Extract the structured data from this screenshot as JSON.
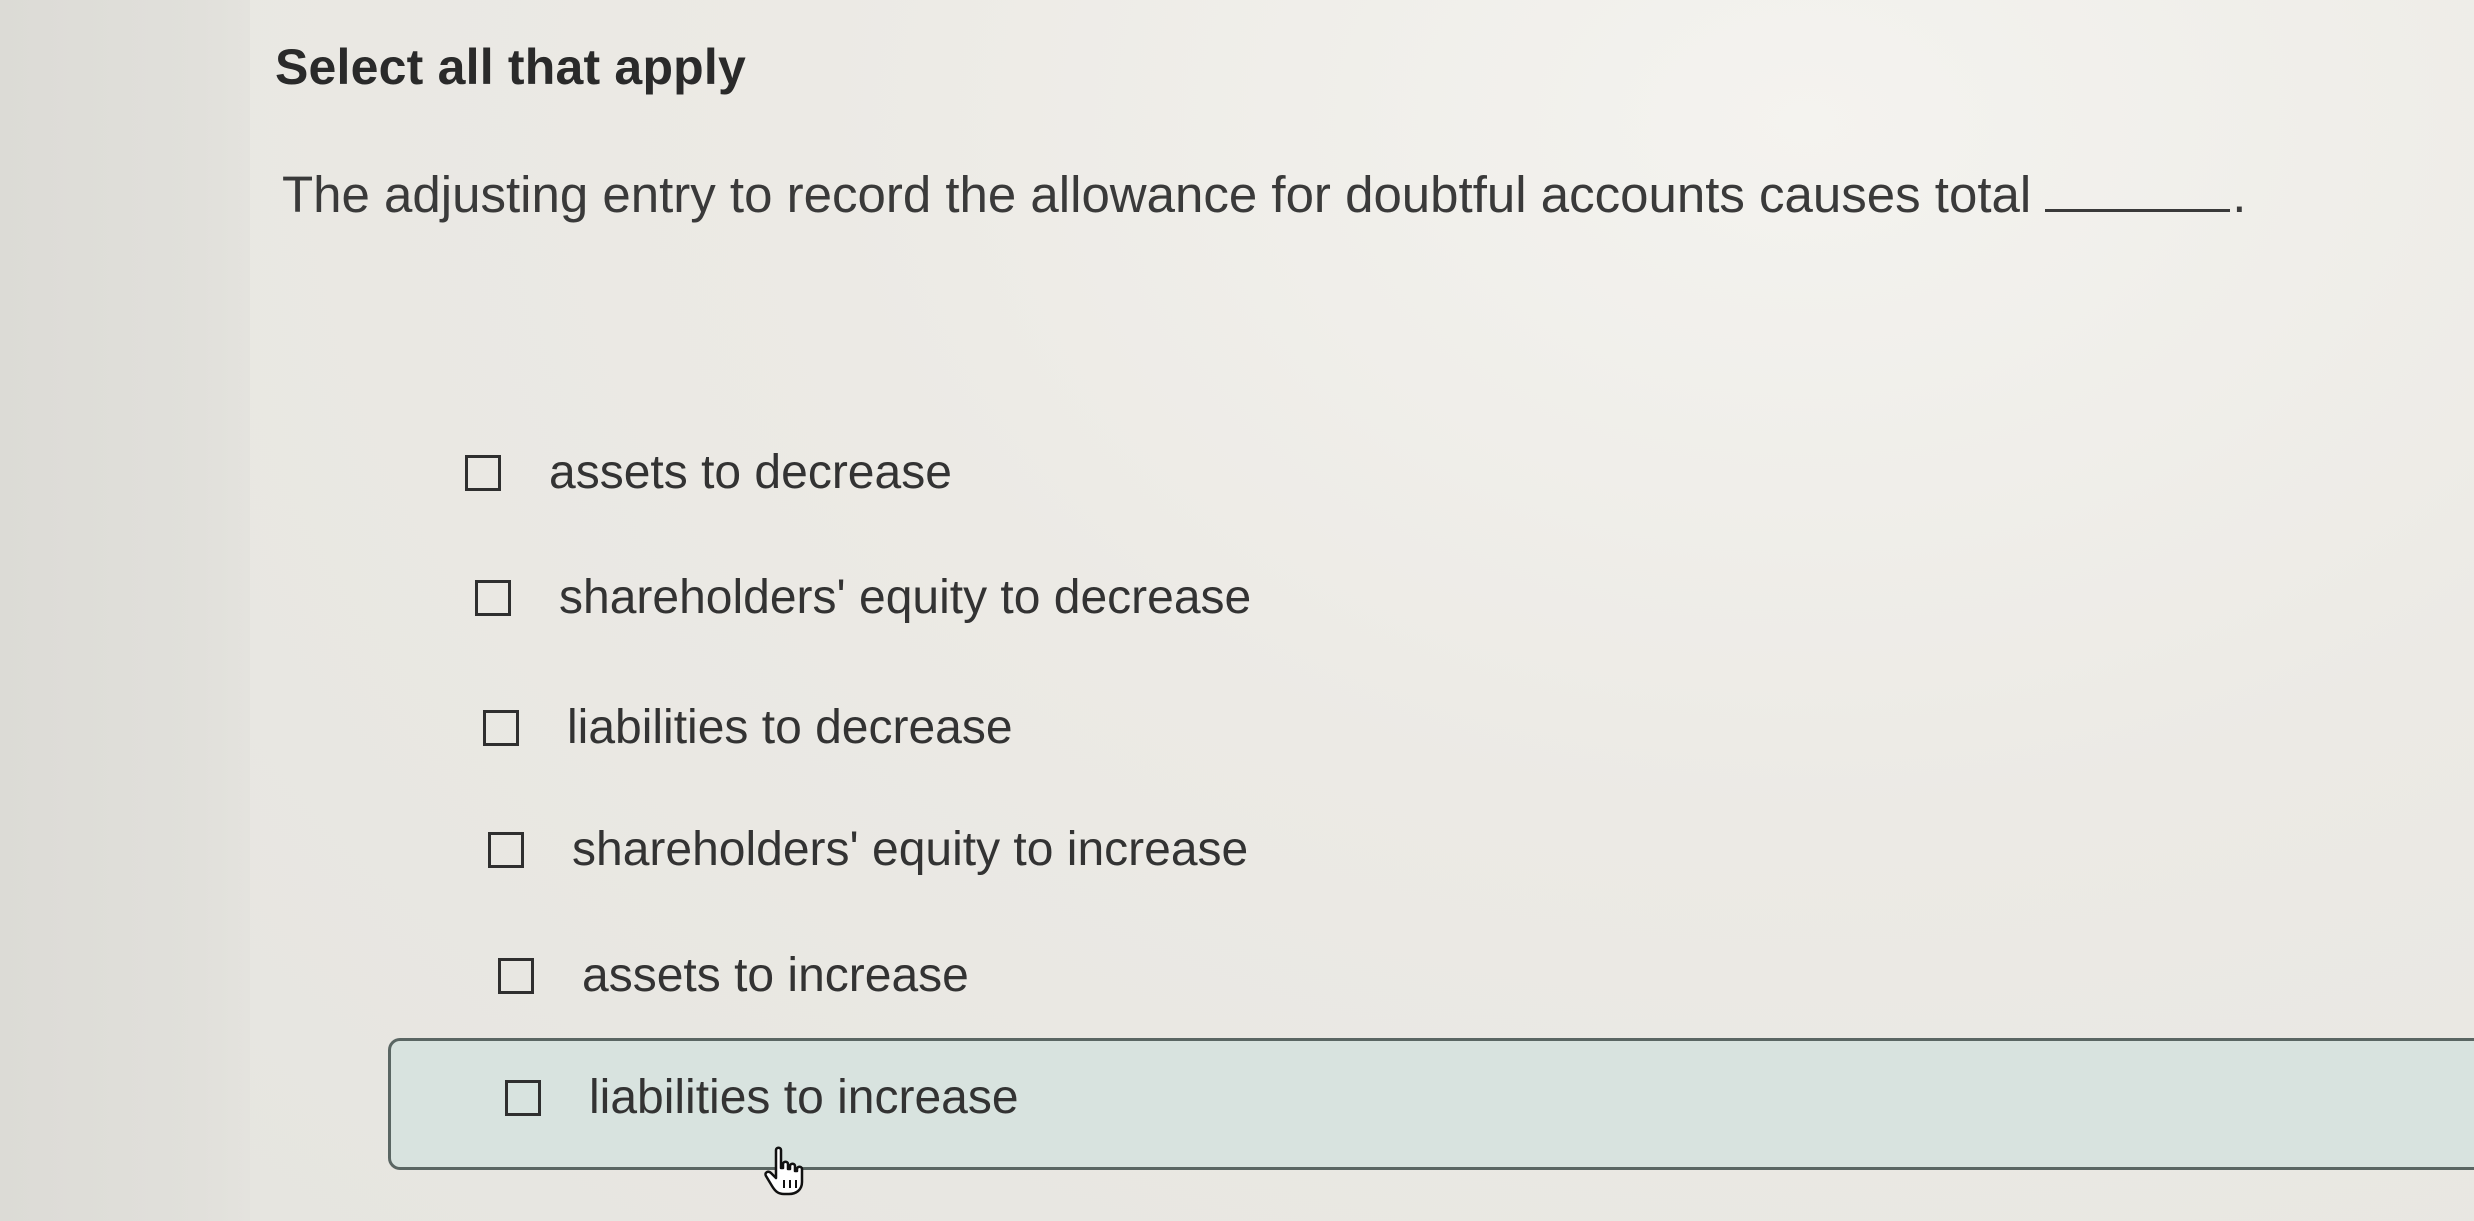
{
  "instruction": "Select all that apply",
  "question": {
    "text": "The adjusting entry to record the allowance for doubtful accounts causes total",
    "end": "."
  },
  "options": [
    {
      "label": "assets to decrease",
      "checked": false
    },
    {
      "label": "shareholders' equity to decrease",
      "checked": false
    },
    {
      "label": "liabilities to decrease",
      "checked": false
    },
    {
      "label": "shareholders' equity to increase",
      "checked": false
    },
    {
      "label": "assets to increase",
      "checked": false
    },
    {
      "label": "liabilities to increase",
      "checked": false,
      "hovered": true
    }
  ],
  "cursor": "hand-pointer-icon",
  "colors": {
    "hover_background": "#d8e3df",
    "hover_border": "#5a6663",
    "text": "#333333"
  }
}
